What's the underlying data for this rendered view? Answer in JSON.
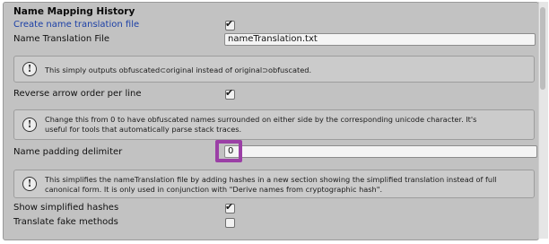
{
  "section": {
    "title": "Name Mapping History"
  },
  "fields": {
    "create_translation_file": {
      "label": "Create name translation file",
      "checked": true
    },
    "translation_file": {
      "label": "Name Translation File",
      "value": "nameTranslation.txt"
    },
    "reverse_arrow": {
      "label": "Reverse arrow order per line",
      "checked": true
    },
    "padding_delimiter": {
      "label": "Name padding delimiter",
      "value": "0"
    },
    "show_simplified_hashes": {
      "label": "Show simplified hashes",
      "checked": true
    },
    "translate_fake_methods": {
      "label": "Translate fake methods",
      "checked": false
    }
  },
  "help": {
    "outputs": {
      "text": "This simply outputs obfuscated⊂original instead of original⊃obfuscated."
    },
    "padding": {
      "line1": "Change this from 0 to have obfuscated names surrounded on either side by the corresponding unicode character. It's",
      "line2": "useful for tools that automatically parse stack traces."
    },
    "simplify": {
      "line1": "This simplifies the nameTranslation file by adding hashes in a new section showing the simplified translation instead of full",
      "line2": "canonical form. It is only used in conjunction with \"Derive names from cryptographic hash\"."
    }
  },
  "glyphs": {
    "info": "!",
    "tick": "✔"
  },
  "colors": {
    "panel": "#c2c2c2",
    "link": "#1b3fa6",
    "highlight": "#9b3fa6"
  }
}
